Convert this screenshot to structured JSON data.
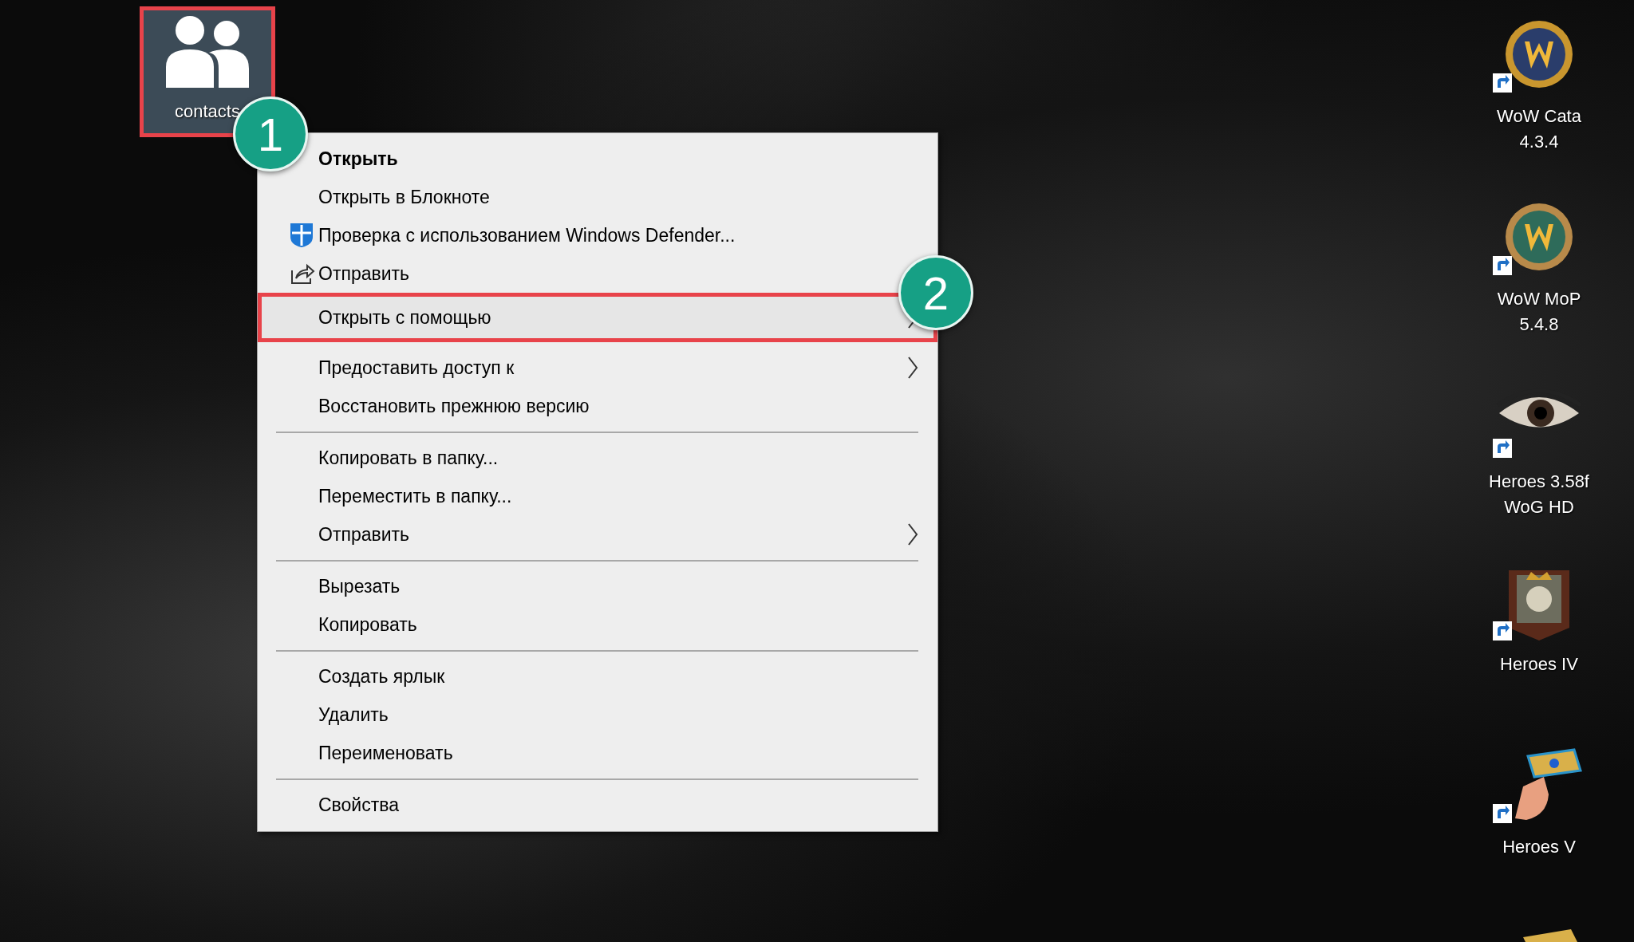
{
  "selected_file": {
    "label": "contacts",
    "selected": true,
    "highlighted": true
  },
  "shortcuts": [
    {
      "kind": "emblem_blue",
      "label_lines": [
        "WoW Cata",
        "4.3.4"
      ]
    },
    {
      "kind": "emblem_green",
      "label_lines": [
        "WoW MoP",
        "5.4.8"
      ]
    },
    {
      "kind": "eye",
      "label_lines": [
        "Heroes 3.58f",
        "WoG HD"
      ]
    },
    {
      "kind": "portrait",
      "label_lines": [
        "Heroes IV"
      ]
    },
    {
      "kind": "hammer",
      "label_lines": [
        "Heroes V"
      ]
    },
    {
      "kind": "partial"
    }
  ],
  "context_menu": {
    "items": [
      {
        "kind": "item",
        "label": "Открыть",
        "bold": true
      },
      {
        "kind": "item",
        "label": "Открыть в Блокноте"
      },
      {
        "kind": "shield_item",
        "label": "Проверка с использованием Windows Defender..."
      },
      {
        "kind": "share_item",
        "label": "Отправить"
      },
      {
        "kind": "item",
        "label": "Открыть с помощью",
        "has_submenu": true,
        "highlighted": true
      },
      {
        "kind": "item",
        "label": "Предоставить доступ к",
        "has_submenu": true
      },
      {
        "kind": "item",
        "label": "Восстановить прежнюю версию"
      },
      {
        "kind": "separator"
      },
      {
        "kind": "item",
        "label": "Копировать в папку..."
      },
      {
        "kind": "item",
        "label": "Переместить в папку..."
      },
      {
        "kind": "item",
        "label": "Отправить",
        "has_submenu": true
      },
      {
        "kind": "separator"
      },
      {
        "kind": "item",
        "label": "Вырезать"
      },
      {
        "kind": "item",
        "label": "Копировать"
      },
      {
        "kind": "separator"
      },
      {
        "kind": "item",
        "label": "Создать ярлык"
      },
      {
        "kind": "item",
        "label": "Удалить"
      },
      {
        "kind": "item",
        "label": "Переименовать"
      },
      {
        "kind": "separator"
      },
      {
        "kind": "item",
        "label": "Свойства"
      }
    ]
  },
  "annotations": [
    {
      "number": "1"
    },
    {
      "number": "2"
    }
  ]
}
